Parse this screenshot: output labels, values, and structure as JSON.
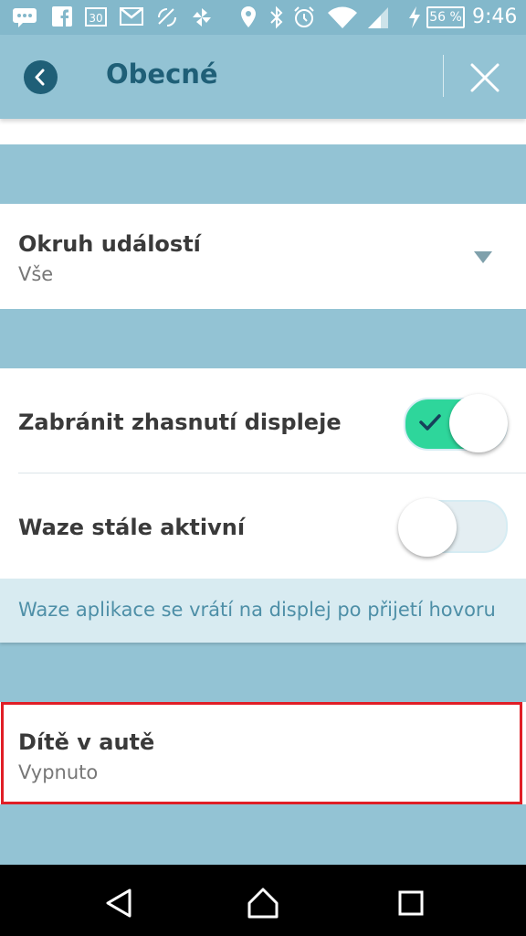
{
  "status_bar": {
    "battery": "56 %",
    "time": "9:46",
    "icons": [
      "messages-icon",
      "facebook-icon",
      "calendar-icon",
      "gmail-icon",
      "nfc-icon",
      "pinwheel-icon",
      "location-icon",
      "bluetooth-icon",
      "alarm-icon",
      "wifi-icon",
      "signal-icon",
      "charging-icon",
      "battery-icon"
    ]
  },
  "header": {
    "title": "Obecné"
  },
  "settings": {
    "event_range": {
      "label": "Okruh událostí",
      "value": "Vše"
    },
    "prevent_sleep": {
      "label": "Zabránit zhasnutí displeje",
      "enabled": true
    },
    "always_active": {
      "label": "Waze stále aktivní",
      "enabled": false
    },
    "note": "Waze aplikace se vrátí na displej po přijetí hovoru",
    "child_in_car": {
      "label": "Dítě v autě",
      "value": "Vypnuto"
    }
  },
  "colors": {
    "background": "#93c3d4",
    "accent": "#1f5f77",
    "toggle_on": "#2ed69b",
    "highlight": "#e01e26"
  }
}
